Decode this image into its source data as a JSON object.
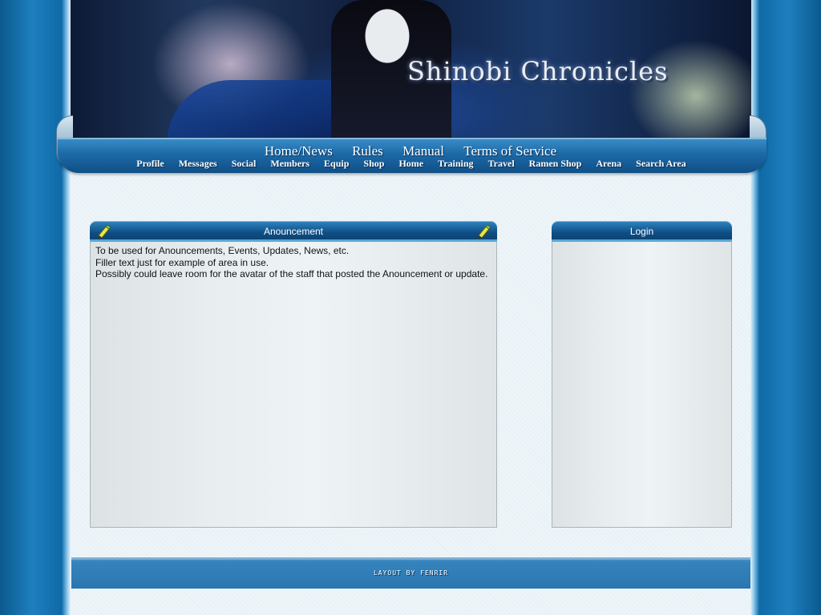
{
  "header": {
    "site_title": "Shinobi Chronicles"
  },
  "main_nav": [
    "Home/News",
    "Rules",
    "Manual",
    "Terms of Service"
  ],
  "sub_nav": [
    "Profile",
    "Messages",
    "Social",
    "Members",
    "Equip",
    "Shop",
    "Home",
    "Training",
    "Travel",
    "Ramen Shop",
    "Arena",
    "Search Area"
  ],
  "announcement": {
    "title": "Anouncement",
    "lines": [
      "To be used for Anouncements, Events, Updates, News, etc.",
      "Filler text just for example of area in use.",
      "Possibly could leave room for the avatar of the staff that posted the Anouncement or update."
    ],
    "icon": "pencil-icon"
  },
  "login": {
    "title": "Login"
  },
  "footer": {
    "credit": "LAYOUT BY FENRIR"
  },
  "colors": {
    "accent": "#0f4f86",
    "background": "#1e7fbf",
    "content": "#eef5f9"
  }
}
